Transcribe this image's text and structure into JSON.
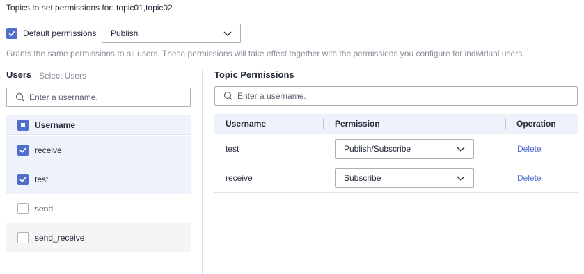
{
  "header": {
    "title": "Topics to set permissions for: topic01,topic02"
  },
  "default_permissions": {
    "checked": true,
    "label": "Default permissions",
    "selected": "Publish",
    "hint": "Grants the same permissions to all users. These permissions will take effect together with the permissions you configure for individual users."
  },
  "users_panel": {
    "title": "Users",
    "subtitle": "Select Users",
    "search_placeholder": "Enter a username.",
    "header_label": "Username",
    "items": [
      {
        "label": "receive",
        "checked": true
      },
      {
        "label": "test",
        "checked": true
      },
      {
        "label": "send",
        "checked": false
      },
      {
        "label": "send_receive",
        "checked": false
      }
    ]
  },
  "topic_permissions": {
    "title": "Topic Permissions",
    "search_placeholder": "Enter a username.",
    "columns": [
      "Username",
      "Permission",
      "Operation"
    ],
    "rows": [
      {
        "username": "test",
        "permission": "Publish/Subscribe",
        "operation": "Delete"
      },
      {
        "username": "receive",
        "permission": "Subscribe",
        "operation": "Delete"
      }
    ]
  },
  "colors": {
    "accent": "#526ecc",
    "header_bg": "#eef2fb",
    "muted_text": "#8a8e99"
  }
}
